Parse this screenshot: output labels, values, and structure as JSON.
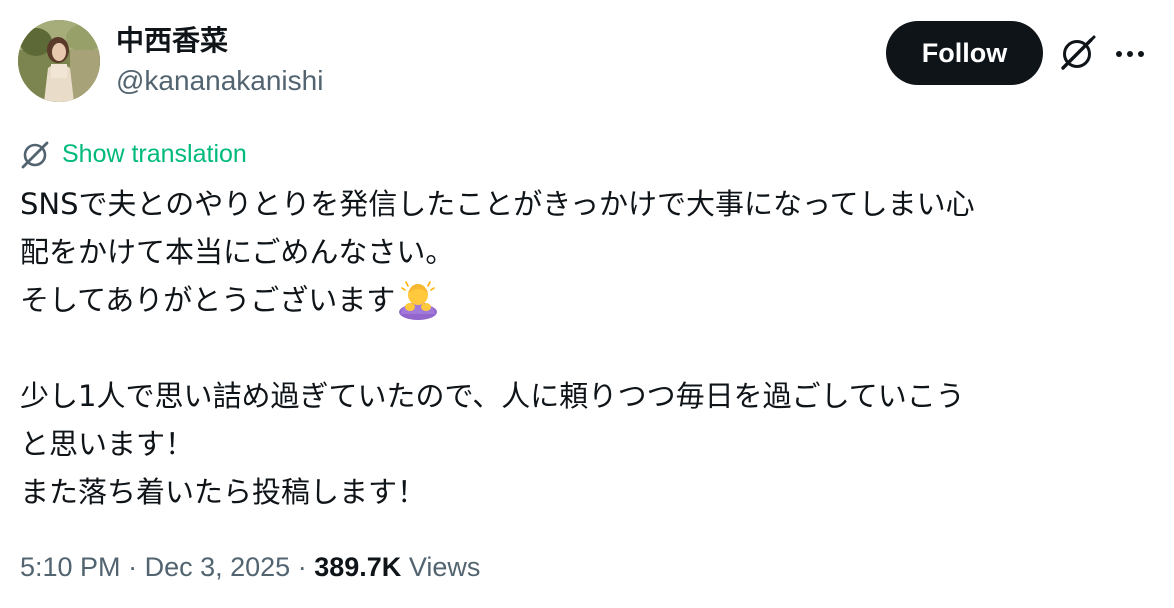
{
  "author": {
    "display_name": "中西香菜",
    "handle": "@kananakanishi",
    "avatar_icon": "profile-photo"
  },
  "actions": {
    "follow_label": "Follow",
    "grok_icon": "grok-icon",
    "more_icon": "more-dots-icon"
  },
  "translation": {
    "icon": "grok-icon",
    "label": "Show translation",
    "color": "#00ba7c"
  },
  "post": {
    "lines": [
      "SNSで夫とのやりとりを発信したことがきっかけで大事になってしまい心",
      "配をかけて本当にごめんなさい。",
      "そしてありがとうございます",
      "",
      "少し1人で思い詰め過ぎていたので、人に頼りつつ毎日を過ごしていこう",
      "と思います！",
      "また落ち着いたら投稿します！"
    ],
    "emoji": "person-bowing-emoji"
  },
  "meta": {
    "time": "5:10 PM",
    "separator": "·",
    "date": "Dec 3, 2025",
    "views_count": "389.7K",
    "views_label": "Views"
  },
  "colors": {
    "text": "#0f1419",
    "secondary": "#536471",
    "follow_bg": "#0f1419",
    "follow_text": "#ffffff"
  }
}
